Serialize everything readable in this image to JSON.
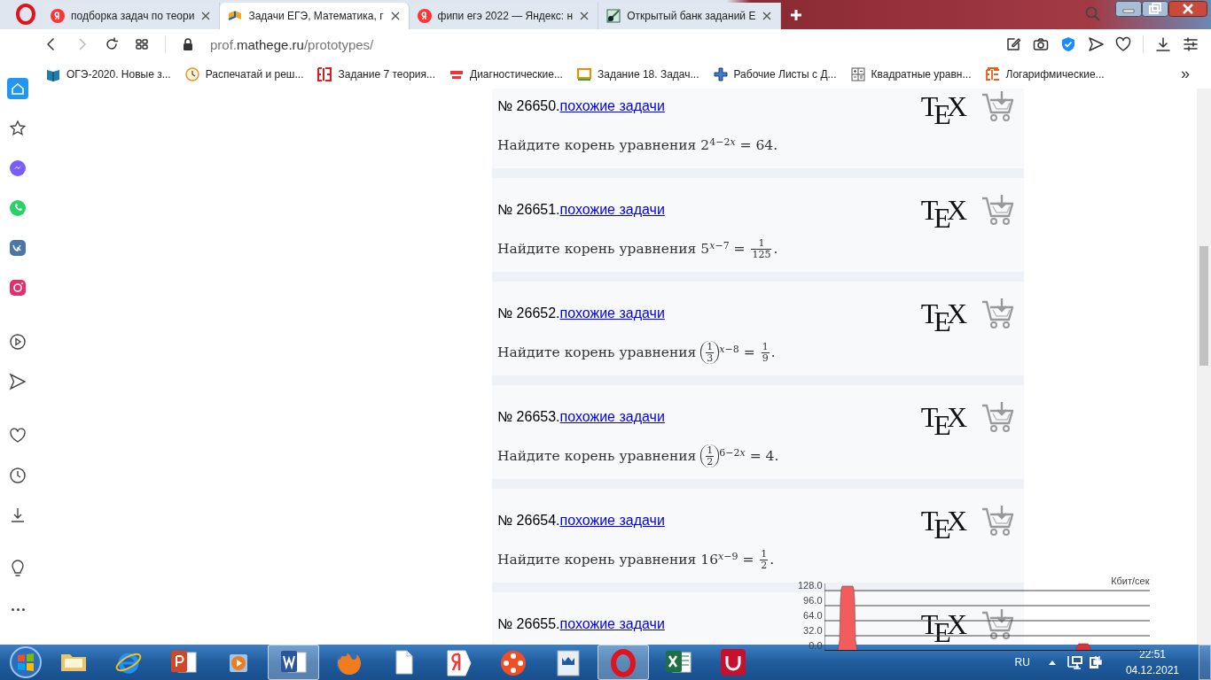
{
  "tabs": [
    {
      "kind": "yandex",
      "title": "подборка задач по теори",
      "selected": false
    },
    {
      "kind": "book",
      "title": "Задачи ЕГЭ, Математика, г",
      "selected": true
    },
    {
      "kind": "yandex",
      "title": "фипи егэ 2022 — Яндекс: н",
      "selected": false
    },
    {
      "kind": "bank",
      "title": "Открытый банк заданий Е",
      "selected": false
    }
  ],
  "address": {
    "prefix": "prof.",
    "domain": "mathege.ru",
    "path": "/prototypes/"
  },
  "bookmarks": [
    {
      "kind": "book",
      "label": "ОГЭ-2020. Новые з..."
    },
    {
      "kind": "clock",
      "label": "Распечатай и реш..."
    },
    {
      "kind": "ege",
      "label": "Задание 7 теория..."
    },
    {
      "kind": "math",
      "label": "Диагностические..."
    },
    {
      "kind": "ege2",
      "label": "Задание 18. Задач..."
    },
    {
      "kind": "plus",
      "label": "Рабочие Листы с Д..."
    },
    {
      "kind": "calc",
      "label": "Квадратные уравн..."
    },
    {
      "kind": "ege3",
      "label": "Логарифмические..."
    }
  ],
  "bookmarks_more": "»",
  "sidebar": [
    {
      "kind": "home",
      "selected": true
    },
    {
      "kind": "star",
      "selected": false
    },
    {
      "kind": "messenger",
      "selected": false
    },
    {
      "kind": "whatsapp",
      "selected": false
    },
    {
      "kind": "vk",
      "selected": false
    },
    {
      "kind": "instagram",
      "selected": false
    },
    {
      "kind": "player",
      "selected": false
    },
    {
      "kind": "send",
      "selected": false
    },
    {
      "kind": "heart",
      "selected": false
    },
    {
      "kind": "clock",
      "selected": false
    },
    {
      "kind": "download",
      "selected": false
    },
    {
      "kind": "bulb",
      "selected": false
    },
    {
      "kind": "more",
      "selected": false
    }
  ],
  "problems": [
    {
      "number": "№ 26650.",
      "link": "похожие задачи",
      "logo_letters": [
        "T",
        "E",
        "X"
      ],
      "statement": [
        {
          "kind": "text",
          "text": "Найдите корень уравнения 2"
        },
        {
          "kind": "sup",
          "parts": [
            {
              "kind": "text",
              "text": "4−2"
            },
            {
              "kind": "var",
              "text": "x"
            }
          ]
        },
        {
          "kind": "text",
          "text": " = 64."
        }
      ]
    },
    {
      "number": "№ 26651.",
      "link": "похожие задачи",
      "logo_letters": [
        "T",
        "E",
        "X"
      ],
      "statement": [
        {
          "kind": "text",
          "text": "Найдите корень уравнения 5"
        },
        {
          "kind": "sup",
          "parts": [
            {
              "kind": "var",
              "text": "x"
            },
            {
              "kind": "text",
              "text": "−7"
            }
          ]
        },
        {
          "kind": "text",
          "text": " = "
        },
        {
          "kind": "frac",
          "num": "1",
          "den": "125"
        },
        {
          "kind": "text",
          "text": "."
        }
      ]
    },
    {
      "number": "№ 26652.",
      "link": "похожие задачи",
      "logo_letters": [
        "T",
        "E",
        "X"
      ],
      "statement": [
        {
          "kind": "text",
          "text": "Найдите корень уравнения "
        },
        {
          "kind": "pfrac",
          "num": "1",
          "den": "3"
        },
        {
          "kind": "sup",
          "parts": [
            {
              "kind": "var",
              "text": "x"
            },
            {
              "kind": "text",
              "text": "−8"
            }
          ]
        },
        {
          "kind": "text",
          "text": " = "
        },
        {
          "kind": "frac",
          "num": "1",
          "den": "9"
        },
        {
          "kind": "text",
          "text": "."
        }
      ]
    },
    {
      "number": "№ 26653.",
      "link": "похожие задачи",
      "logo_letters": [
        "T",
        "E",
        "X"
      ],
      "statement": [
        {
          "kind": "text",
          "text": "Найдите корень уравнения "
        },
        {
          "kind": "pfrac",
          "num": "1",
          "den": "2"
        },
        {
          "kind": "sup",
          "parts": [
            {
              "kind": "text",
              "text": "6−2"
            },
            {
              "kind": "var",
              "text": "x"
            }
          ]
        },
        {
          "kind": "text",
          "text": " = 4."
        }
      ]
    },
    {
      "number": "№ 26654.",
      "link": "похожие задачи",
      "logo_letters": [
        "T",
        "E",
        "X"
      ],
      "statement": [
        {
          "kind": "text",
          "text": "Найдите корень уравнения 16"
        },
        {
          "kind": "sup",
          "parts": [
            {
              "kind": "var",
              "text": "x"
            },
            {
              "kind": "text",
              "text": "−9"
            }
          ]
        },
        {
          "kind": "text",
          "text": " = "
        },
        {
          "kind": "frac",
          "num": "1",
          "den": "2"
        },
        {
          "kind": "text",
          "text": "."
        }
      ]
    },
    {
      "number": "№ 26655.",
      "link": "похожие задачи",
      "logo_letters": [
        "T",
        "E",
        "X"
      ]
    }
  ],
  "net_meter": {
    "unit": "Кбит/сек",
    "ticks": [
      "128.0",
      "96.0",
      "64.0",
      "32.0",
      "0.0"
    ]
  },
  "taskbar": {
    "items": [
      {
        "kind": "explorer",
        "selected": false
      },
      {
        "kind": "ie",
        "selected": false
      },
      {
        "kind": "powerpoint",
        "selected": false
      },
      {
        "kind": "mediaplayer",
        "selected": false
      },
      {
        "kind": "word",
        "selected": true
      },
      {
        "kind": "firefox",
        "selected": false
      },
      {
        "kind": "file",
        "selected": false
      },
      {
        "kind": "yandex",
        "selected": false
      },
      {
        "kind": "reel",
        "selected": false
      },
      {
        "kind": "app",
        "selected": false
      },
      {
        "kind": "opera",
        "selected": true
      },
      {
        "kind": "excel",
        "selected": false
      },
      {
        "kind": "redapp",
        "selected": false
      }
    ],
    "lang": "RU",
    "time": "22:51",
    "date": "04.12.2021"
  }
}
